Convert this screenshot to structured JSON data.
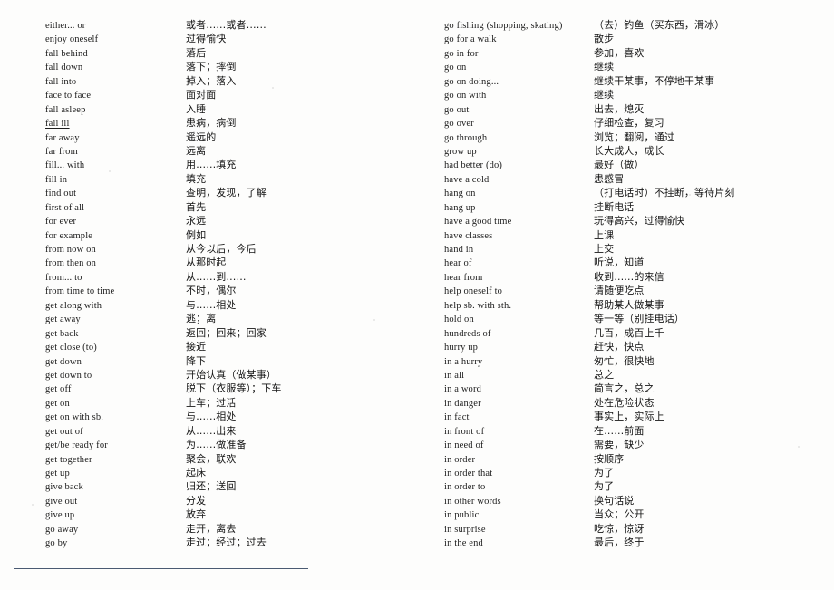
{
  "page": {
    "kind": "scanned-book-page",
    "rule_color": "#4a5a72",
    "background_color": "#fdfdfc",
    "text_color": "#1a1a1a"
  },
  "columns": [
    {
      "id": "left",
      "entries": [
        {
          "term": "either... or",
          "gloss": "或者……或者……"
        },
        {
          "term": "enjoy oneself",
          "gloss": "过得愉快"
        },
        {
          "term": "fall behind",
          "gloss": "落后"
        },
        {
          "term": "fall down",
          "gloss": "落下；摔倒"
        },
        {
          "term": "fall into",
          "gloss": "掉入；落入"
        },
        {
          "term": "face to face",
          "gloss": "面对面"
        },
        {
          "term": "fall asleep",
          "gloss": "入睡"
        },
        {
          "term": "fall ill",
          "gloss": "患病，病倒",
          "underlined": true
        },
        {
          "term": "far away",
          "gloss": "遥远的"
        },
        {
          "term": "far from",
          "gloss": "远离"
        },
        {
          "term": "fill... with",
          "gloss": "用……填充"
        },
        {
          "term": "fill in",
          "gloss": "填充"
        },
        {
          "term": "find out",
          "gloss": "查明，发现，了解"
        },
        {
          "term": "first of all",
          "gloss": "首先"
        },
        {
          "term": "for ever",
          "gloss": "永远"
        },
        {
          "term": "for example",
          "gloss": "例如"
        },
        {
          "term": "from now on",
          "gloss": "从今以后，今后"
        },
        {
          "term": "from then on",
          "gloss": "从那时起"
        },
        {
          "term": "from... to",
          "gloss": "从……到……"
        },
        {
          "term": "from time to time",
          "gloss": "不时，偶尔"
        },
        {
          "term": "get along with",
          "gloss": "与……相处"
        },
        {
          "term": "get away",
          "gloss": "逃；离"
        },
        {
          "term": "get back",
          "gloss": "返回；回来；回家"
        },
        {
          "term": "get close (to)",
          "gloss": "接近"
        },
        {
          "term": "get down",
          "gloss": "降下"
        },
        {
          "term": "get down to",
          "gloss": "开始认真（做某事）"
        },
        {
          "term": "get off",
          "gloss": "脱下（衣服等）；下车"
        },
        {
          "term": "get on",
          "gloss": "上车；过活"
        },
        {
          "term": "get on with sb.",
          "gloss": "与……相处"
        },
        {
          "term": "get out of",
          "gloss": "从……出来"
        },
        {
          "term": "get/be ready for",
          "gloss": "为……做准备"
        },
        {
          "term": "get together",
          "gloss": "聚会，联欢"
        },
        {
          "term": "get up",
          "gloss": "起床"
        },
        {
          "term": "give back",
          "gloss": "归还；送回"
        },
        {
          "term": "give out",
          "gloss": "分发"
        },
        {
          "term": "give up",
          "gloss": "放弃"
        },
        {
          "term": "go away",
          "gloss": "走开，离去"
        },
        {
          "term": "go by",
          "gloss": "走过；经过；过去"
        }
      ]
    },
    {
      "id": "right",
      "entries": [
        {
          "term": "go fishing (shopping, skating)",
          "gloss": "（去）钓鱼（买东西，滑冰）"
        },
        {
          "term": "go for a walk",
          "gloss": "散步"
        },
        {
          "term": "go in for",
          "gloss": "参加，喜欢"
        },
        {
          "term": "go on",
          "gloss": "继续"
        },
        {
          "term": "go on doing...",
          "gloss": "继续干某事，不停地干某事"
        },
        {
          "term": "go on with",
          "gloss": "继续"
        },
        {
          "term": "go out",
          "gloss": "出去，熄灭"
        },
        {
          "term": "go over",
          "gloss": "仔细检查，复习"
        },
        {
          "term": "go through",
          "gloss": "浏览；翻阅，通过"
        },
        {
          "term": "grow up",
          "gloss": "长大成人，成长"
        },
        {
          "term": "had better (do)",
          "gloss": "最好（做）"
        },
        {
          "term": "have a cold",
          "gloss": "患感冒"
        },
        {
          "term": "hang on",
          "gloss": "（打电话时）不挂断，等待片刻"
        },
        {
          "term": "hang up",
          "gloss": "挂断电话"
        },
        {
          "term": "have a good time",
          "gloss": "玩得高兴，过得愉快"
        },
        {
          "term": "have classes",
          "gloss": "上课"
        },
        {
          "term": "hand in",
          "gloss": "上交"
        },
        {
          "term": "hear of",
          "gloss": "听说，知道"
        },
        {
          "term": "hear from",
          "gloss": "收到……的来信"
        },
        {
          "term": "help oneself to",
          "gloss": "请随便吃点"
        },
        {
          "term": "help sb. with sth.",
          "gloss": "帮助某人做某事"
        },
        {
          "term": "hold on",
          "gloss": "等一等（别挂电话）"
        },
        {
          "term": "hundreds of",
          "gloss": "几百，成百上千"
        },
        {
          "term": "hurry up",
          "gloss": "赶快，快点"
        },
        {
          "term": "in a hurry",
          "gloss": "匆忙，很快地"
        },
        {
          "term": "in all",
          "gloss": "总之"
        },
        {
          "term": "in a word",
          "gloss": "简言之，总之"
        },
        {
          "term": "in danger",
          "gloss": "处在危险状态"
        },
        {
          "term": "in fact",
          "gloss": "事实上，实际上"
        },
        {
          "term": "in front of",
          "gloss": "在……前面"
        },
        {
          "term": "in need of",
          "gloss": "需要，缺少"
        },
        {
          "term": "in order",
          "gloss": "按顺序"
        },
        {
          "term": "in order that",
          "gloss": "为了"
        },
        {
          "term": "in order to",
          "gloss": "为了"
        },
        {
          "term": "in other words",
          "gloss": "换句话说"
        },
        {
          "term": "in public",
          "gloss": "当众；公开"
        },
        {
          "term": "in surprise",
          "gloss": "吃惊，惊讶"
        },
        {
          "term": "in the end",
          "gloss": "最后，终于"
        }
      ]
    }
  ]
}
